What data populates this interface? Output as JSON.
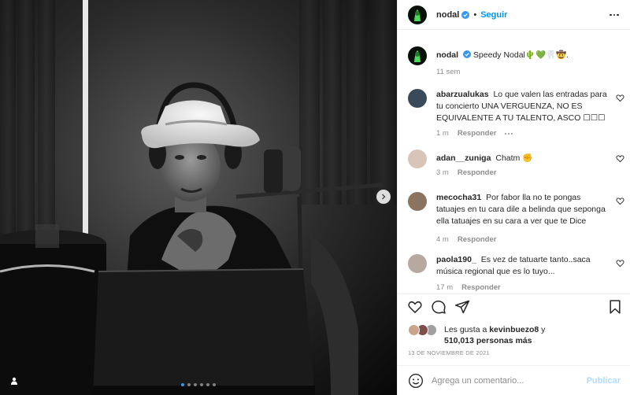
{
  "post": {
    "author": "nodal",
    "follow_label": "Seguir",
    "separator": "•",
    "caption": {
      "username": "nodal",
      "text": "Speedy Nodal🌵💚🦷🤠.",
      "time": "11 sem"
    },
    "carousel": {
      "total": 6,
      "active_index": 0
    }
  },
  "comments": [
    {
      "username": "abarzualukas",
      "text": "Lo que valen las entradas para tu concierto UNA VERGUENZA, NO ES EQUIVALENTE A TU TALENTO, ASCO ☐☐☐",
      "time": "1 m",
      "reply": "Responder",
      "avatar_color": "#3a4a5a"
    },
    {
      "username": "adan__zuniga",
      "text": "Chatm ✊",
      "time": "3 m",
      "reply": "Responder",
      "avatar_color": "#d9c4b8"
    },
    {
      "username": "mecocha31",
      "text": "Por fabor lla no te pongas tatuajes en tu cara dile a belinda que seponga ella tatuajes en su cara a ver que te Dice",
      "time": "4 m",
      "reply": "Responder",
      "avatar_color": "#8a7460"
    },
    {
      "username": "paola190_",
      "text": "Es vez de tatuarte tanto..saca música regional que es lo tuyo...",
      "time": "17 m",
      "reply": "Responder",
      "avatar_color": "#b7a9a0"
    }
  ],
  "likes": {
    "prefix": "Les gusta a",
    "user": "kevinbuezo8",
    "suffix": "y",
    "count_text": "510,013 personas más",
    "liker_colors": [
      "#c9a38a",
      "#7d4f48",
      "#a0a0a0"
    ]
  },
  "date": "13 DE NOVIEMBRE DE 2021",
  "comment_box": {
    "placeholder": "Agrega un comentario...",
    "publish": "Publicar"
  },
  "colors": {
    "accent": "#0095f6",
    "publish_disabled": "#b3dbff",
    "muted": "#8e8e8e"
  },
  "icons": [
    "heart-icon",
    "comment-icon",
    "share-icon",
    "bookmark-icon",
    "emoji-icon",
    "verified-icon",
    "more-options-icon",
    "next-arrow-icon",
    "user-tag-icon"
  ]
}
